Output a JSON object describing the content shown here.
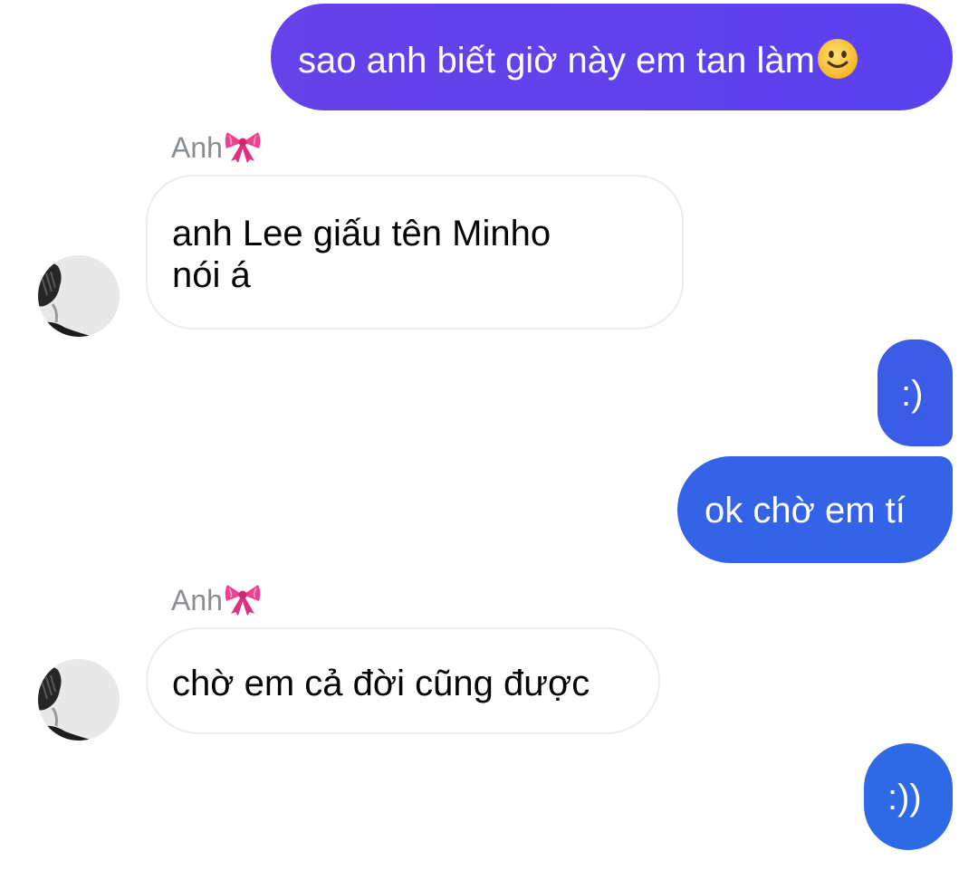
{
  "colors": {
    "outgoing_gradient_start": "#6542ea",
    "outgoing_gradient_end": "#5b41ee",
    "outgoing_blue": "#2f6ae6",
    "incoming_border": "#ececec",
    "sender_name": "#8a8d91"
  },
  "messages": [
    {
      "direction": "outgoing",
      "text": "sao anh biết giờ này em tan làm",
      "trailing_icon": "slightly-smiling-face-emoji"
    },
    {
      "direction": "incoming",
      "sender": "Anh",
      "sender_icon": "ribbon-emoji",
      "lines": [
        "anh Lee giấu tên Minho",
        "nói á"
      ]
    },
    {
      "direction": "outgoing",
      "text": ":)"
    },
    {
      "direction": "outgoing",
      "text": "ok chờ em tí"
    },
    {
      "direction": "incoming",
      "sender": "Anh",
      "sender_icon": "ribbon-emoji",
      "lines": [
        "chờ em cả đời cũng được"
      ]
    },
    {
      "direction": "outgoing",
      "text": ":))"
    }
  ]
}
